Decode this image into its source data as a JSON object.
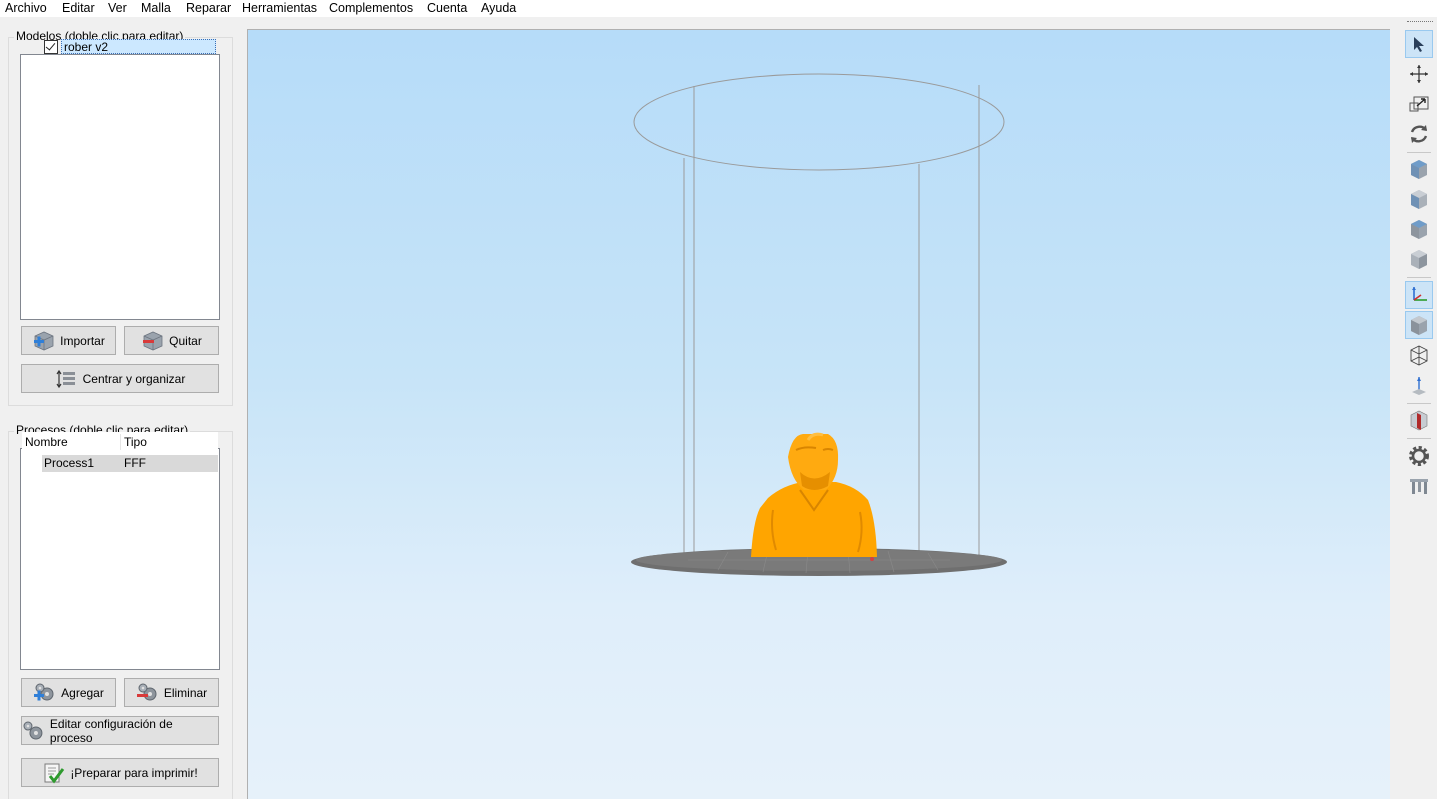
{
  "menu": [
    "Archivo",
    "Editar",
    "Ver",
    "Malla",
    "Reparar",
    "Herramientas",
    "Complementos",
    "Cuenta",
    "Ayuda"
  ],
  "models_panel": {
    "title": "Modelos (doble clic para editar)",
    "items": [
      {
        "label": "rober v2",
        "checked": true
      }
    ],
    "import_label": "Importar",
    "remove_label": "Quitar",
    "center_label": "Centrar y organizar"
  },
  "processes_panel": {
    "title": "Procesos (doble clic para editar)",
    "columns": [
      "Nombre",
      "Tipo"
    ],
    "rows": [
      {
        "name": "Process1",
        "type": "FFF"
      }
    ],
    "add_label": "Agregar",
    "delete_label": "Eliminar",
    "edit_label": "Editar configuración de proceso",
    "prepare_label": "¡Preparar para imprimir!"
  },
  "toolbar": {
    "icons": [
      "select-cursor-icon",
      "move-icon",
      "scale-icon",
      "rotate-icon",
      "view-iso-cube-icon",
      "view-front-cube-icon",
      "view-top-cube-icon",
      "view-side-cube-icon",
      "axes-icon",
      "solid-view-icon",
      "wireframe-view-icon",
      "z-axis-icon",
      "cross-section-icon",
      "settings-gear-icon",
      "supports-icon"
    ],
    "active": [
      "select-cursor-icon",
      "axes-icon",
      "solid-view-icon"
    ]
  },
  "colors": {
    "model": "#ffa500",
    "bed": "#6f6f6f",
    "sky_top": "#b6dcf9",
    "sky_bottom": "#e6f1fa"
  }
}
